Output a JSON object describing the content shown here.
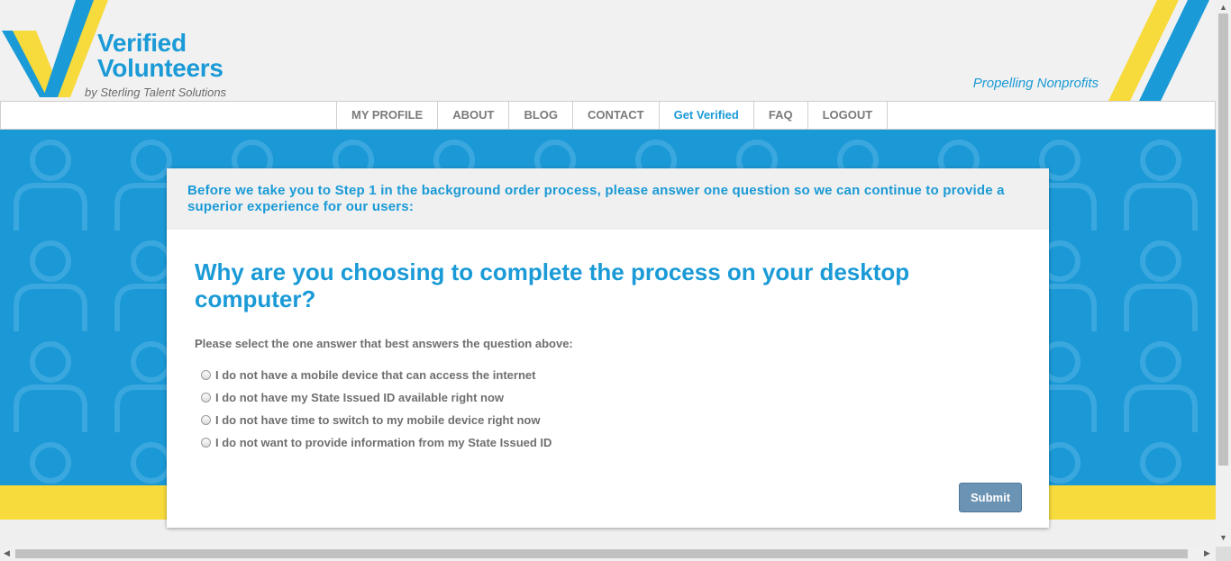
{
  "brand": {
    "title_line1": "Verified",
    "title_line2": "Volunteers",
    "subtitle": "by Sterling Talent Solutions",
    "tagline": "Propelling Nonprofits",
    "colors": {
      "blue": "#1a9ad6",
      "yellow": "#f7da3b",
      "gray": "#7b7b7b"
    }
  },
  "nav": {
    "items": [
      {
        "label": "MY PROFILE"
      },
      {
        "label": "ABOUT"
      },
      {
        "label": "BLOG"
      },
      {
        "label": "CONTACT"
      },
      {
        "label": "Get Verified",
        "active": true
      },
      {
        "label": "FAQ"
      },
      {
        "label": "LOGOUT"
      }
    ]
  },
  "card": {
    "intro": "Before we take you to Step 1 in the background order process, please answer one question so we can continue to provide a superior experience for our users:",
    "question": "Why are you choosing to complete the process on your desktop computer?",
    "instruction": "Please select the one answer that best answers the question above:",
    "options": [
      {
        "label": "I do not have a mobile device that can access the internet",
        "selected": false
      },
      {
        "label": "I do not have my State Issued ID available right now",
        "selected": false
      },
      {
        "label": "I do not have time to switch to my mobile device right now",
        "selected": false
      },
      {
        "label": "I do not want to provide information from my State Issued ID",
        "selected": false
      }
    ],
    "submit_label": "Submit"
  }
}
